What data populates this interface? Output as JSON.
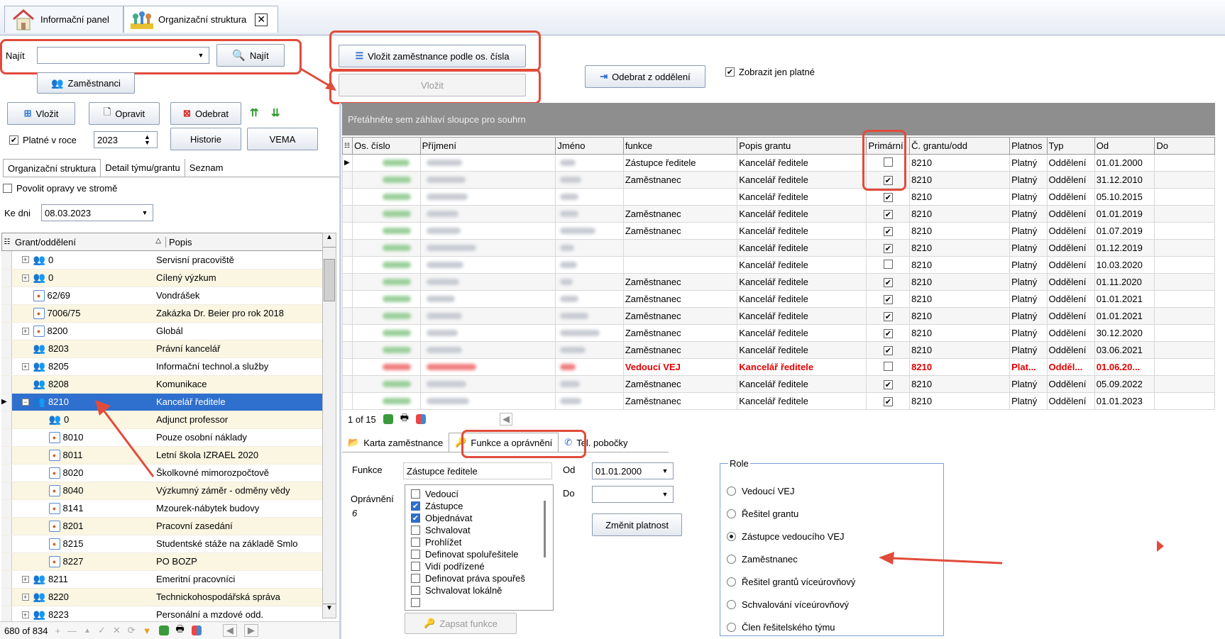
{
  "tabs": [
    {
      "label": "Informační panel"
    },
    {
      "label": "Organizační struktura"
    }
  ],
  "search": {
    "label": "Najít",
    "value": "",
    "button": "Najít"
  },
  "buttons": {
    "employees": "Zaměstnanci",
    "insert": "Vložit",
    "edit": "Opravit",
    "remove": "Odebrat",
    "history": "Historie",
    "vema": "VEMA",
    "insert_by_id": "Vložit zaměstnance podle os. čísla",
    "insert_disabled": "Vložit",
    "remove_from_dept": "Odebrat z oddělení",
    "change_validity": "Změnit platnost",
    "save_function": "Zapsat funkce"
  },
  "filters": {
    "valid_in_year_label": "Platné v roce",
    "year": "2023",
    "show_valid_label": "Zobrazit jen platné",
    "allow_edits_label": "Povolit opravy ve stromě",
    "as_of_label": "Ke dni",
    "as_of_date": "08.03.2023"
  },
  "left_tabs": [
    "Organizační struktura",
    "Detail týmu/grantu",
    "Seznam"
  ],
  "tree": {
    "headers": [
      "Grant/oddělení",
      "Popis"
    ],
    "rows": [
      {
        "code": "0",
        "desc": "Servisní pracoviště",
        "icon": "people-icon",
        "level": 1,
        "exp": "+"
      },
      {
        "code": "0",
        "desc": "Cílený výzkum",
        "icon": "people-icon",
        "level": 1,
        "exp": "+"
      },
      {
        "code": "62/69",
        "desc": "Vondrášek",
        "icon": "grant-icon",
        "level": 1,
        "exp": ""
      },
      {
        "code": "7006/75",
        "desc": "Zakázka Dr. Beier pro rok 2018",
        "icon": "grant-icon",
        "level": 1,
        "exp": ""
      },
      {
        "code": "8200",
        "desc": "Globál",
        "icon": "grant-icon",
        "level": 1,
        "exp": "+"
      },
      {
        "code": "8203",
        "desc": "Právní kancelář",
        "icon": "people-icon",
        "level": 1,
        "exp": ""
      },
      {
        "code": "8205",
        "desc": "Informační technol.a služby",
        "icon": "people-icon",
        "level": 1,
        "exp": "+"
      },
      {
        "code": "8208",
        "desc": "Komunikace",
        "icon": "people-icon",
        "level": 1,
        "exp": ""
      },
      {
        "code": "8210",
        "desc": "Kancelář ředitele",
        "icon": "people-icon",
        "level": 1,
        "exp": "−",
        "sel": true
      },
      {
        "code": "0",
        "desc": "Adjunct professor",
        "icon": "people-icon",
        "level": 2,
        "exp": ""
      },
      {
        "code": "8010",
        "desc": "Pouze osobní náklady",
        "icon": "grant-icon",
        "level": 2,
        "exp": ""
      },
      {
        "code": "8011",
        "desc": "Letní škola IZRAEL 2020",
        "icon": "grant-icon",
        "level": 2,
        "exp": ""
      },
      {
        "code": "8020",
        "desc": "Školkovné mimorozpočtově",
        "icon": "grant-icon",
        "level": 2,
        "exp": ""
      },
      {
        "code": "8040",
        "desc": "Výzkumný záměr - odměny vědy",
        "icon": "grant-icon",
        "level": 2,
        "exp": ""
      },
      {
        "code": "8141",
        "desc": "Mzourek-nábytek budovy",
        "icon": "grant-icon",
        "level": 2,
        "exp": ""
      },
      {
        "code": "8201",
        "desc": "Pracovní zasedání",
        "icon": "grant-icon",
        "level": 2,
        "exp": ""
      },
      {
        "code": "8215",
        "desc": "Studentské stáže na základě Smlo",
        "icon": "grant-icon",
        "level": 2,
        "exp": ""
      },
      {
        "code": "8227",
        "desc": "PO BOZP",
        "icon": "grant-icon",
        "level": 2,
        "exp": ""
      },
      {
        "code": "8211",
        "desc": "Emeritní pracovníci",
        "icon": "people-icon",
        "level": 1,
        "exp": "+"
      },
      {
        "code": "8220",
        "desc": "Technickohospodářská správa",
        "icon": "people-icon",
        "level": 1,
        "exp": "+"
      },
      {
        "code": "8223",
        "desc": "Personální a mzdové odd.",
        "icon": "people-icon",
        "level": 1,
        "exp": "+"
      }
    ],
    "pager": "680 of 834"
  },
  "grid": {
    "group_hint": "Přetáhněte sem záhlaví sloupce pro souhrn",
    "headers": [
      "Os. číslo",
      "Příjmení",
      "Jméno",
      "funkce",
      "Popis grantu",
      "Primární",
      "Č. grantu/odd",
      "Platnos",
      "Typ",
      "Od",
      "Do"
    ],
    "rows": [
      {
        "funkce": "Zástupce ředitele",
        "popis": "Kancelář ředitele",
        "prim": false,
        "grant": "8210",
        "platnost": "Platný",
        "typ": "Oddělení",
        "od": "01.01.2000",
        "do": "",
        "w": [
          38,
          50,
          22
        ]
      },
      {
        "funkce": "Zaměstnanec",
        "popis": "Kancelář ředitele",
        "prim": true,
        "grant": "8210",
        "platnost": "Platný",
        "typ": "Oddělení",
        "od": "31.12.2010",
        "do": "",
        "w": [
          40,
          55,
          30
        ]
      },
      {
        "funkce": "",
        "popis": "Kancelář ředitele",
        "prim": true,
        "grant": "8210",
        "platnost": "Platný",
        "typ": "Oddělení",
        "od": "05.10.2015",
        "do": "",
        "w": [
          40,
          58,
          26
        ]
      },
      {
        "funkce": "Zaměstnanec",
        "popis": "Kancelář ředitele",
        "prim": true,
        "grant": "8210",
        "platnost": "Platný",
        "typ": "Oddělení",
        "od": "01.01.2019",
        "do": "",
        "w": [
          40,
          45,
          26
        ]
      },
      {
        "funkce": "Zaměstnanec",
        "popis": "Kancelář ředitele",
        "prim": true,
        "grant": "8210",
        "platnost": "Platný",
        "typ": "Oddělení",
        "od": "01.07.2019",
        "do": "",
        "w": [
          40,
          48,
          50
        ]
      },
      {
        "funkce": "",
        "popis": "Kancelář ředitele",
        "prim": true,
        "grant": "8210",
        "platnost": "Platný",
        "typ": "Oddělení",
        "od": "01.12.2019",
        "do": "",
        "w": [
          40,
          70,
          20
        ]
      },
      {
        "funkce": "",
        "popis": "Kancelář ředitele",
        "prim": false,
        "grant": "8210",
        "platnost": "Platný",
        "typ": "Oddělení",
        "od": "10.03.2020",
        "do": "",
        "w": [
          40,
          52,
          24
        ]
      },
      {
        "funkce": "Zaměstnanec",
        "popis": "Kancelář ředitele",
        "prim": true,
        "grant": "8210",
        "platnost": "Platný",
        "typ": "Oddělení",
        "od": "01.11.2020",
        "do": "",
        "w": [
          40,
          46,
          18
        ]
      },
      {
        "funkce": "Zaměstnanec",
        "popis": "Kancelář ředitele",
        "prim": true,
        "grant": "8210",
        "platnost": "Platný",
        "typ": "Oddělení",
        "od": "01.01.2021",
        "do": "",
        "w": [
          40,
          40,
          26
        ]
      },
      {
        "funkce": "Zaměstnanec",
        "popis": "Kancelář ředitele",
        "prim": true,
        "grant": "8210",
        "platnost": "Platný",
        "typ": "Oddělení",
        "od": "01.01.2021",
        "do": "",
        "w": [
          40,
          50,
          40
        ]
      },
      {
        "funkce": "Zaměstnanec",
        "popis": "Kancelář ředitele",
        "prim": true,
        "grant": "8210",
        "platnost": "Platný",
        "typ": "Oddělení",
        "od": "30.12.2020",
        "do": "",
        "w": [
          40,
          44,
          56
        ]
      },
      {
        "funkce": "Zaměstnanec",
        "popis": "Kancelář ředitele",
        "prim": true,
        "grant": "8210",
        "platnost": "Platný",
        "typ": "Oddělení",
        "od": "03.06.2021",
        "do": "",
        "w": [
          40,
          50,
          36
        ]
      },
      {
        "funkce": "Vedoucí VEJ",
        "popis": "Kancelář ředitele",
        "prim": false,
        "grant": "8210",
        "platnost": "Plat...",
        "typ": "Odděl...",
        "od": "01.06.20...",
        "do": "",
        "w": [
          40,
          70,
          22
        ],
        "red": true
      },
      {
        "funkce": "Zaměstnanec",
        "popis": "Kancelář ředitele",
        "prim": true,
        "grant": "8210",
        "platnost": "Platný",
        "typ": "Oddělení",
        "od": "05.09.2022",
        "do": "",
        "w": [
          40,
          56,
          28
        ]
      },
      {
        "funkce": "Zaměstnanec",
        "popis": "Kancelář ředitele",
        "prim": true,
        "grant": "8210",
        "platnost": "Platný",
        "typ": "Oddělení",
        "od": "01.01.2023",
        "do": "",
        "w": [
          40,
          60,
          30
        ]
      }
    ],
    "pager": "1 of 15"
  },
  "detail_tabs": [
    "Karta zaměstnance",
    "Funkce a oprávnění",
    "Tel. pobočky"
  ],
  "detail": {
    "function_label": "Funkce",
    "function_value": "Zástupce ředitele",
    "permissions_label": "Oprávnění",
    "permissions_count": "6",
    "from_label": "Od",
    "from_value": "01.01.2000",
    "to_label": "Do",
    "to_value": "",
    "permissions": [
      {
        "label": "Vedoucí",
        "checked": false
      },
      {
        "label": "Zástupce",
        "checked": true
      },
      {
        "label": "Objednávat",
        "checked": true
      },
      {
        "label": "Schvalovat",
        "checked": false
      },
      {
        "label": "Prohlížet",
        "checked": false
      },
      {
        "label": "Definovat spoluřešitele",
        "checked": false
      },
      {
        "label": "Vidí podřízené",
        "checked": false
      },
      {
        "label": "Definovat práva spouřeš",
        "checked": false
      },
      {
        "label": "Schvalovat lokálně",
        "checked": false
      },
      {
        "label": "",
        "checked": false
      }
    ],
    "role_title": "Role",
    "roles": [
      {
        "label": "Vedoucí VEJ",
        "on": false
      },
      {
        "label": "Řešitel grantu",
        "on": false
      },
      {
        "label": "Zástupce vedoucího VEJ",
        "on": true
      },
      {
        "label": "Zaměstnanec",
        "on": false
      },
      {
        "label": "Řešitel grantů víceúrovňový",
        "on": false
      },
      {
        "label": "Schvalování víceúrovňový",
        "on": false
      },
      {
        "label": "Člen řešitelského týmu",
        "on": false
      }
    ]
  },
  "colors": {
    "selection": "#2f6fce",
    "annotation": "#e14b3b",
    "group_bar": "#8e8e8e",
    "row_alt": "#fbf6e2",
    "error_text": "#e60000"
  }
}
